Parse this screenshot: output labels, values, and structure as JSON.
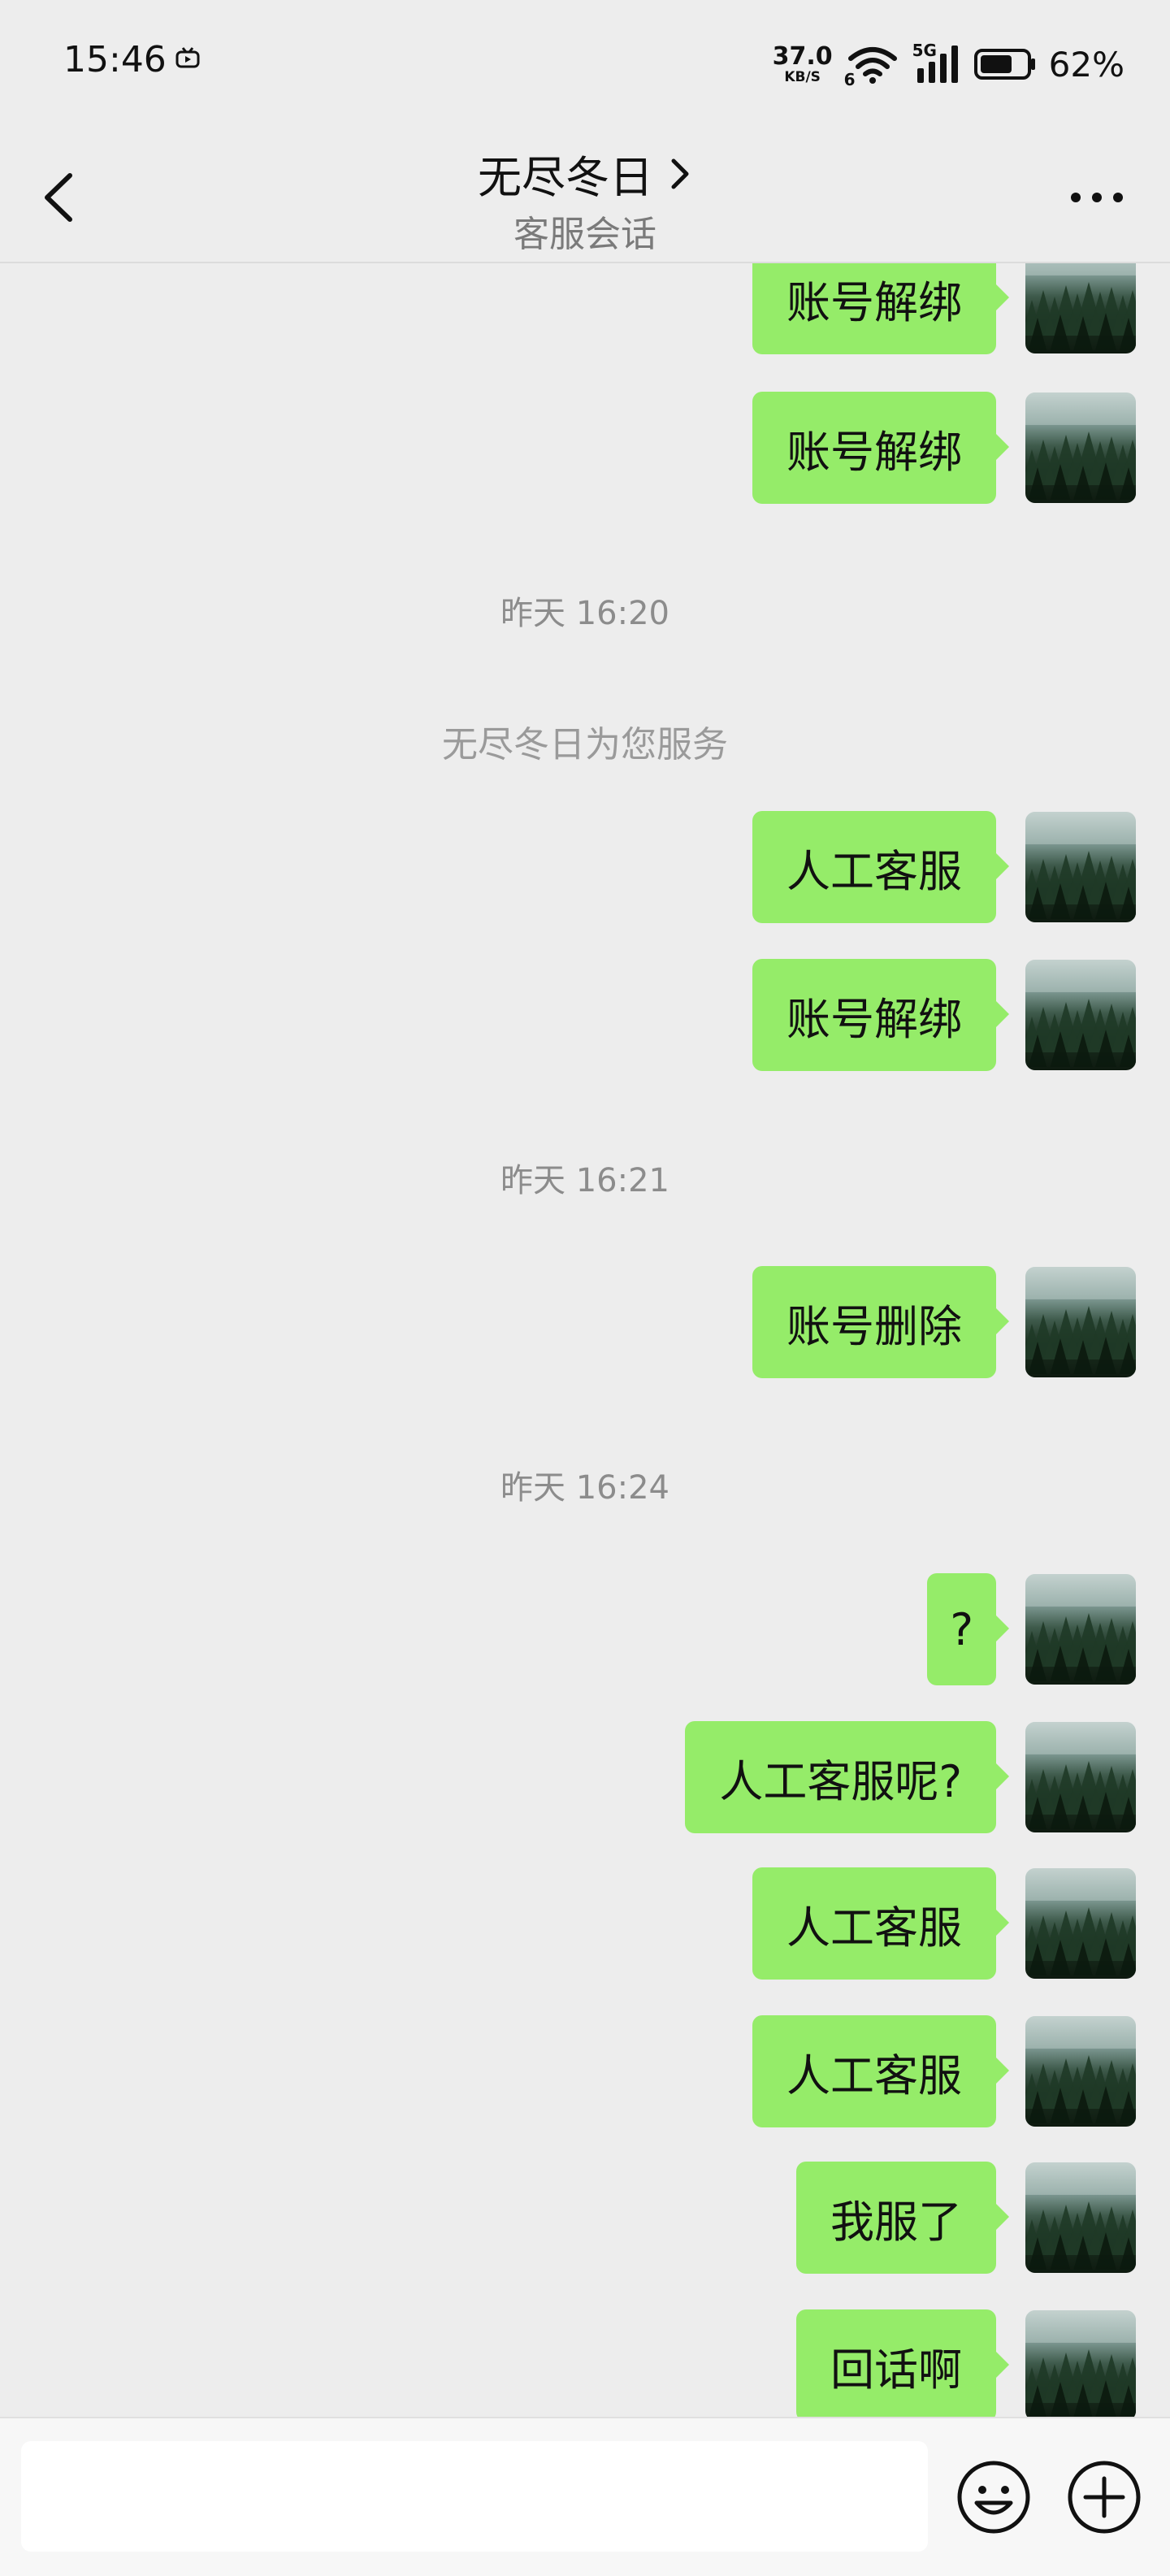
{
  "status_bar": {
    "time": "15:46",
    "net_speed_value": "37.0",
    "net_speed_unit": "KB/S",
    "wifi_badge": "6",
    "signal_badge": "5G",
    "battery_percent": "62%"
  },
  "header": {
    "title": "无尽冬日",
    "subtitle": "客服会话"
  },
  "messages": [
    {
      "text": "账号解绑"
    },
    {
      "text": "账号解绑"
    },
    {
      "time": "昨天 16:20"
    },
    {
      "system": "无尽冬日为您服务"
    },
    {
      "text": "人工客服"
    },
    {
      "text": "账号解绑"
    },
    {
      "time": "昨天 16:21"
    },
    {
      "text": "账号删除"
    },
    {
      "time": "昨天 16:24"
    },
    {
      "text": "?"
    },
    {
      "text": "人工客服呢?"
    },
    {
      "text": "人工客服"
    },
    {
      "text": "人工客服"
    },
    {
      "text": "我服了"
    },
    {
      "text": "回话啊"
    }
  ],
  "input_bar": {
    "value": ""
  },
  "icons": {
    "back": "chevron-left-icon",
    "title_arrow": "chevron-right-icon",
    "more": "more-dots-icon",
    "emoji": "emoji-icon",
    "plus": "plus-circle-icon",
    "app": "tv-icon"
  },
  "colors": {
    "background": "#ededed",
    "bubble": "#95ec69",
    "input_bar": "#f7f7f7"
  }
}
